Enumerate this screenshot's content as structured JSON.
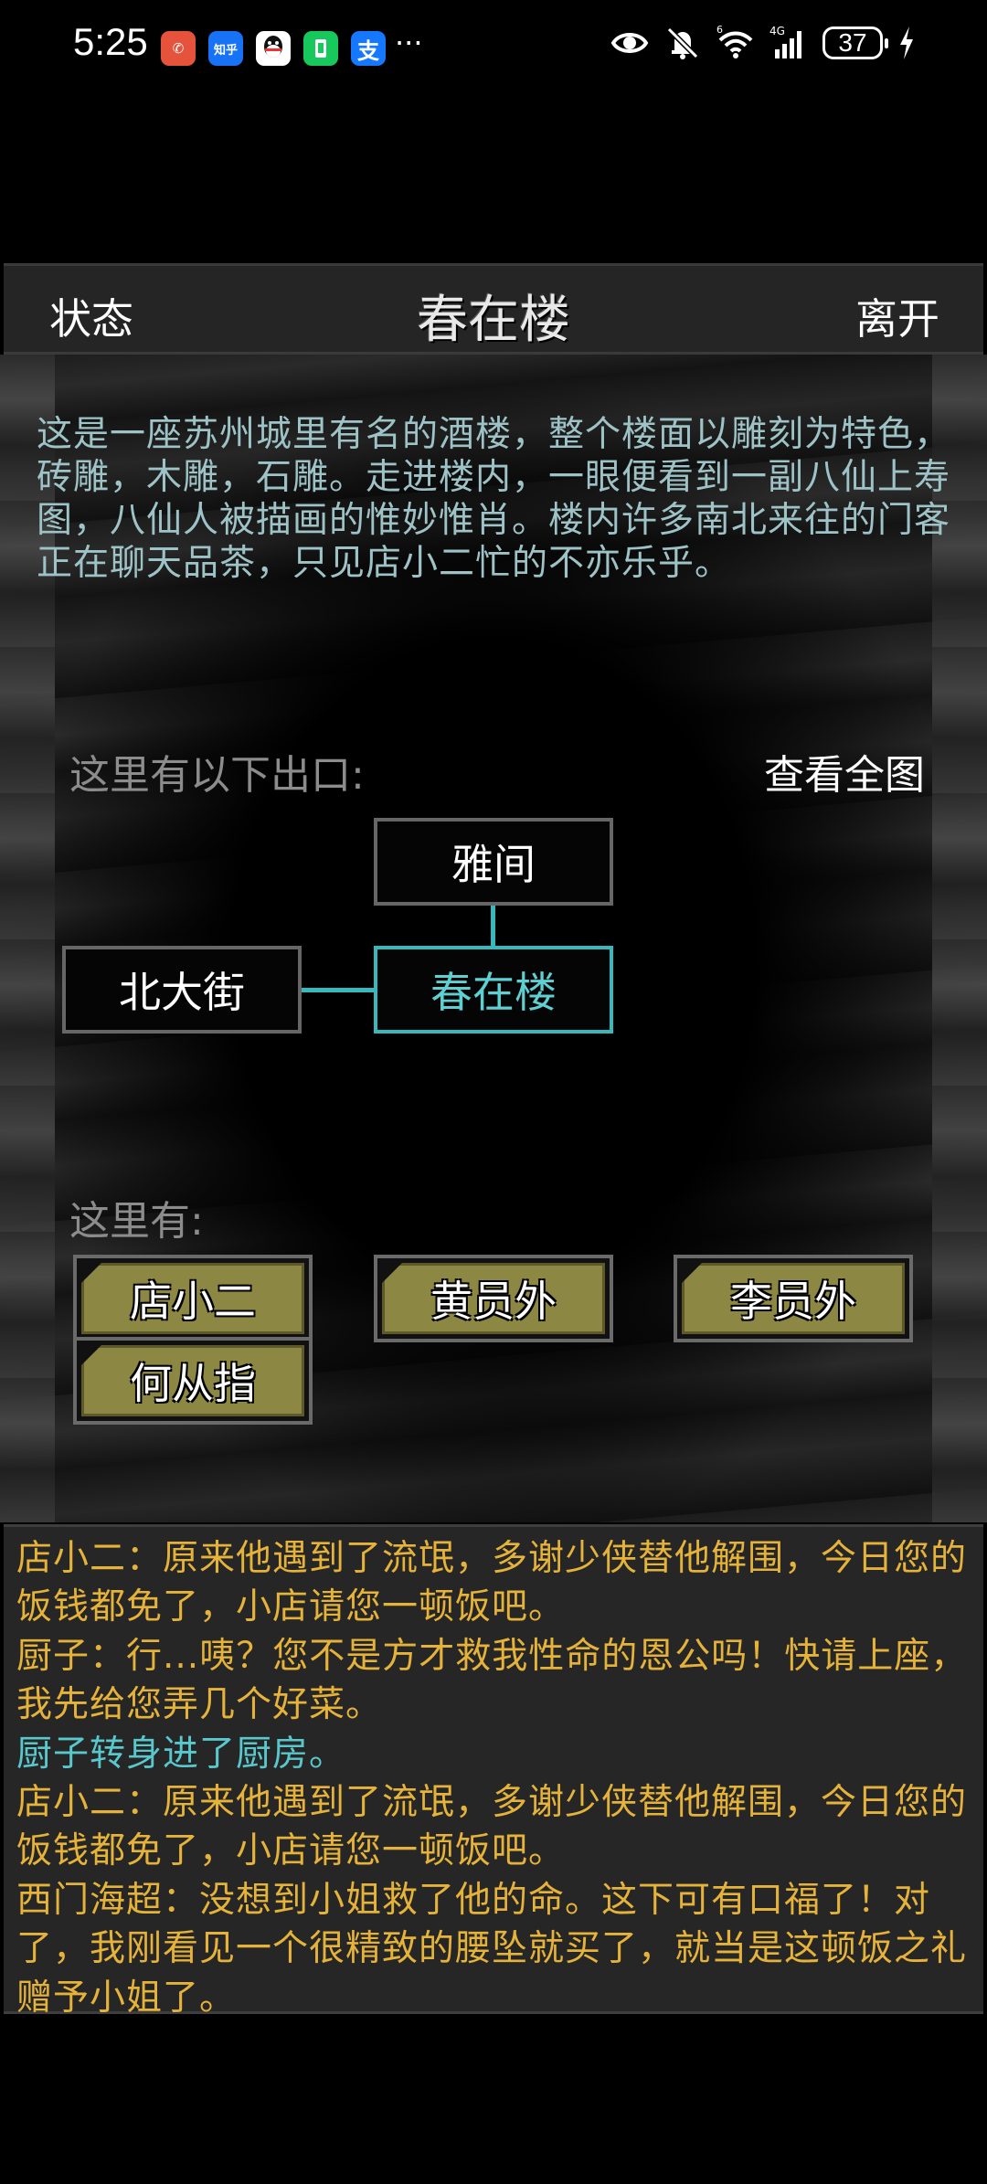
{
  "statusbar": {
    "time": "5:25",
    "apps": [
      {
        "name": "missed-call-icon",
        "glyph": "✆",
        "color": "#e5533d"
      },
      {
        "name": "zhihu-icon",
        "glyph": "知乎",
        "color": "#1772f6"
      },
      {
        "name": "qq-icon",
        "glyph": "◉",
        "color": "#ffffff"
      },
      {
        "name": "wechat-pay-icon",
        "glyph": "▮",
        "color": "#17c85c"
      },
      {
        "name": "alipay-icon",
        "glyph": "支",
        "color": "#1677ff"
      }
    ],
    "more": "···",
    "signal_label": "4G",
    "wifi_label": "6",
    "battery": "37"
  },
  "header": {
    "status_button": "状态",
    "title": "春在楼",
    "leave_button": "离开"
  },
  "description": "这是一座苏州城里有名的酒楼，整个楼面以雕刻为特色，砖雕，木雕，石雕。走进楼内，一眼便看到一副八仙上寿图，八仙人被描画的惟妙惟肖。楼内许多南北来往的门客正在聊天品茶，只见店小二忙的不亦乐乎。",
  "exits": {
    "label": "这里有以下出口:",
    "view_map": "查看全图",
    "rooms": {
      "north": "雅间",
      "west": "北大街",
      "current": "春在楼"
    }
  },
  "here": {
    "label": "这里有:",
    "npcs": [
      "店小二",
      "黄员外",
      "李员外",
      "何从指"
    ]
  },
  "log": [
    {
      "text": "店小二：原来他遇到了流氓，多谢少侠替他解围，今日您的饭钱都免了，小店请您一顿饭吧。",
      "color": "#e5b23a"
    },
    {
      "text": "厨子：行...咦？您不是方才救我性命的恩公吗！快请上座，我先给您弄几个好菜。",
      "color": "#e5b23a"
    },
    {
      "text": "厨子转身进了厨房。",
      "color": "#58c8cc"
    },
    {
      "text": "店小二：原来他遇到了流氓，多谢少侠替他解围，今日您的饭钱都免了，小店请您一顿饭吧。",
      "color": "#e5b23a"
    },
    {
      "text": "西门海超：没想到小姐救了他的命。这下可有口福了！对了，我刚看见一个很精致的腰坠就买了，就当是这顿饭之礼赠予小姐了。",
      "color": "#e5b23a"
    }
  ]
}
